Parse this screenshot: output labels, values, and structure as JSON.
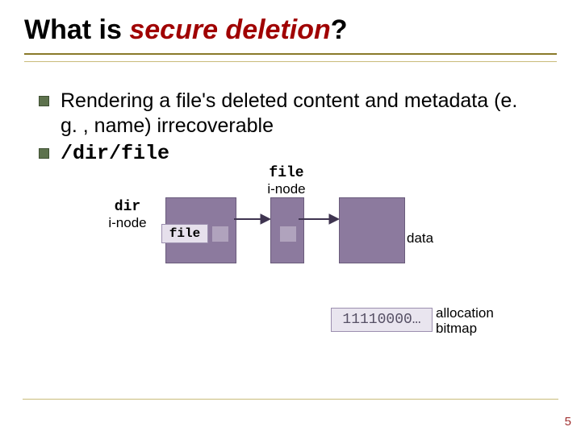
{
  "title": {
    "plain1": "What is ",
    "red": "secure deletion",
    "plain2": "?"
  },
  "bullets": [
    "Rendering a file's deleted content and metadata (e. g. , name) irrecoverable",
    "/dir/file"
  ],
  "labels": {
    "dir_inode_line1": "dir",
    "dir_inode_line2": "i-node",
    "file_inode_line1": "file",
    "file_inode_line2": "i-node",
    "file_slot": "file",
    "data": "data",
    "alloc_line1": "allocation",
    "alloc_line2": "bitmap",
    "bitmap_value": "11110000…"
  },
  "slide_number": "5"
}
